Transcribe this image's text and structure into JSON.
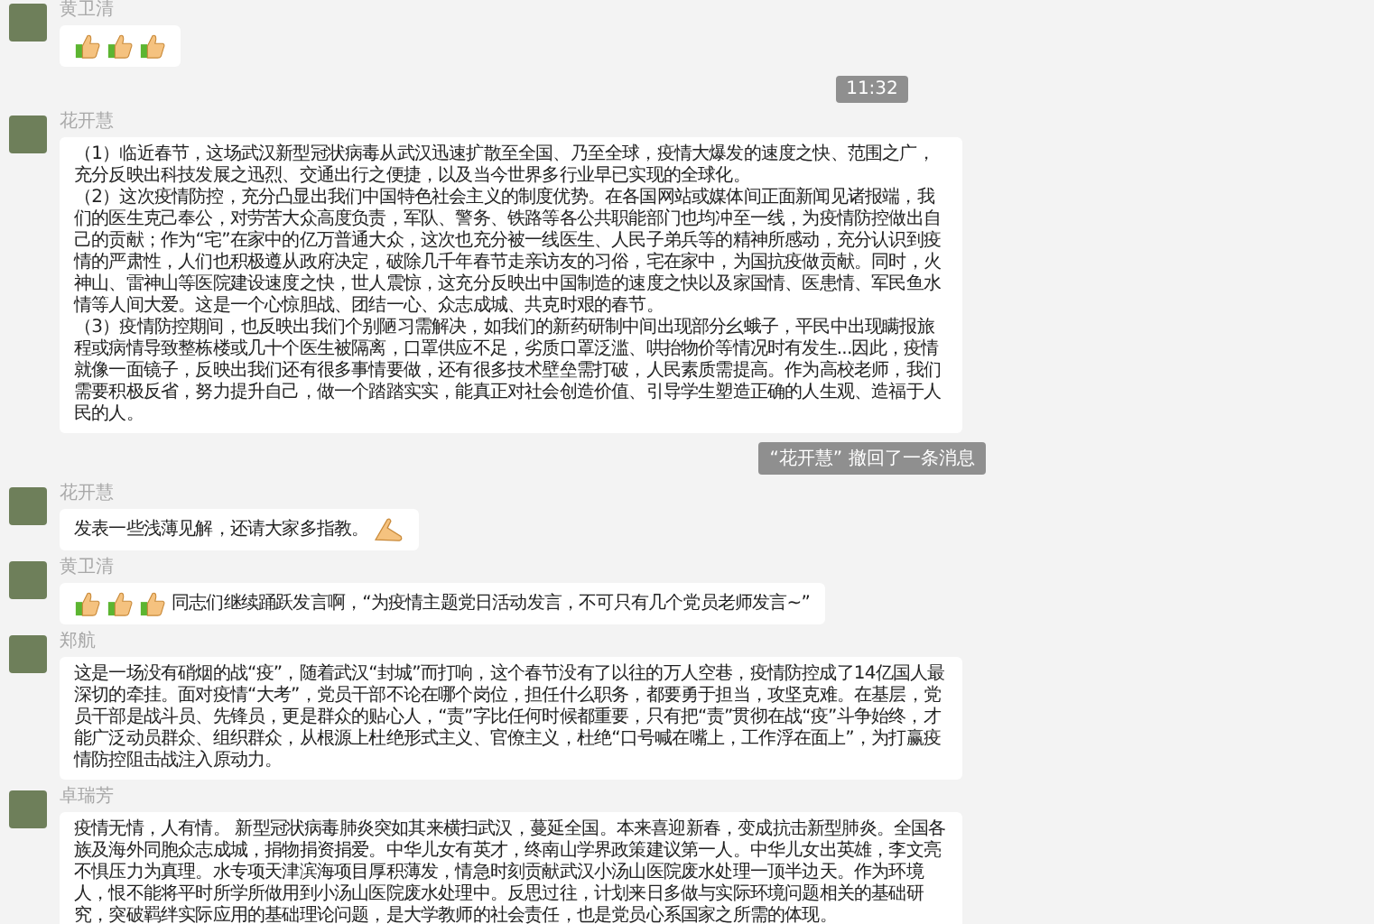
{
  "messages": [
    {
      "kind": "message",
      "sender": "黄卫清",
      "paragraphs": [
        [
          {
            "kind": "thumbs"
          },
          {
            "kind": "thumbs"
          },
          {
            "kind": "thumbs"
          }
        ]
      ]
    },
    {
      "kind": "time",
      "text": "11:32"
    },
    {
      "kind": "message",
      "sender": "花开慧",
      "paragraphs": [
        [
          {
            "kind": "text",
            "text": "（1）临近春节，这场武汉新型冠状病毒从武汉迅速扩散至全国、乃至全球，疫情大爆发的速度之快、范围之广，充分反映出科技发展之迅烈、交通出行之便捷，以及当今世界多行业早已实现的全球化。"
          }
        ],
        [
          {
            "kind": "text",
            "text": "（2）这次疫情防控，充分凸显出我们中国特色社会主义的制度优势。在各国网站或媒体间正面新闻见诸报端，我们的医生克己奉公，对劳苦大众高度负责，军队、警务、铁路等各公共职能部门也均冲至一线，为疫情防控做出自己的贡献；作为“宅”在家中的亿万普通大众，这次也充分被一线医生、人民子弟兵等的精神所感动，充分认识到疫情的严肃性，人们也积极遵从政府决定，破除几千年春节走亲访友的习俗，宅在家中，为国抗疫做贡献。同时，火神山、雷神山等医院建设速度之快，世人震惊，这充分反映出中国制造的速度之快以及家国情、医患情、军民鱼水情等人间大爱。这是一个心惊胆战、团结一心、众志成城、共克时艰的春节。"
          }
        ],
        [
          {
            "kind": "text",
            "text": "（3）疫情防控期间，也反映出我们个别陋习需解决，如我们的新药研制中间出现部分幺蛾子，平民中出现瞒报旅程或病情导致整栋楼或几十个医生被隔离，口罩供应不足，劣质口罩泛滥、哄抬物价等情况时有发生...因此，疫情就像一面镜子，反映出我们还有很多事情要做，还有很多技术壁垒需打破，人民素质需提高。作为高校老师，我们需要积极反省，努力提升自己，做一个踏踏实实，能真正对社会创造价值、引导学生塑造正确的人生观、造福于人民的人。"
          }
        ]
      ]
    },
    {
      "kind": "notice",
      "text": "“花开慧” 撤回了一条消息"
    },
    {
      "kind": "message",
      "sender": "花开慧",
      "paragraphs": [
        [
          {
            "kind": "text",
            "text": "发表一些浅薄见解，还请大家多指教。"
          },
          {
            "kind": "hands"
          }
        ]
      ]
    },
    {
      "kind": "message",
      "sender": "黄卫清",
      "paragraphs": [
        [
          {
            "kind": "thumbs"
          },
          {
            "kind": "thumbs"
          },
          {
            "kind": "thumbs"
          },
          {
            "kind": "text",
            "text": "同志们继续踊跃发言啊，“为疫情主题党日活动发言，不可只有几个党员老师发言~”"
          }
        ]
      ]
    },
    {
      "kind": "message",
      "sender": "郑航",
      "paragraphs": [
        [
          {
            "kind": "text",
            "text": "这是一场没有硝烟的战“疫”，随着武汉“封城”而打响，这个春节没有了以往的万人空巷，疫情防控成了14亿国人最深切的牵挂。面对疫情“大考”，党员干部不论在哪个岗位，担任什么职务，都要勇于担当，攻坚克难。在基层，党员干部是战斗员、先锋员，更是群众的贴心人，“责”字比任何时候都重要，只有把“责”贯彻在战“疫”斗争始终，才能广泛动员群众、组织群众，从根源上杜绝形式主义、官僚主义，杜绝“口号喊在嘴上，工作浮在面上”，为打赢疫情防控阻击战注入原动力。"
          }
        ]
      ]
    },
    {
      "kind": "message",
      "sender": "卓瑞芳",
      "paragraphs": [
        [
          {
            "kind": "text",
            "text": "疫情无情，人有情。 新型冠状病毒肺炎突如其来横扫武汉，蔓延全国。本来喜迎新春，变成抗击新型肺炎。全国各族及海外同胞众志成城，捐物捐资捐爱。中华儿女有英才，终南山学界政策建议第一人。中华儿女出英雄，李文亮不惧压力为真理。水专项天津滨海项目厚积薄发，情急时刻贡献武汉小汤山医院废水处理一顶半边天。作为环境人，恨不能将平时所学所做用到小汤山医院废水处理中。反思过往，计划来日多做与实际环境问题相关的基础研究，突破羁绊实际应用的基础理论问题，是大学教师的社会责任，也是党员心系国家之所需的体现。"
          }
        ]
      ]
    }
  ]
}
